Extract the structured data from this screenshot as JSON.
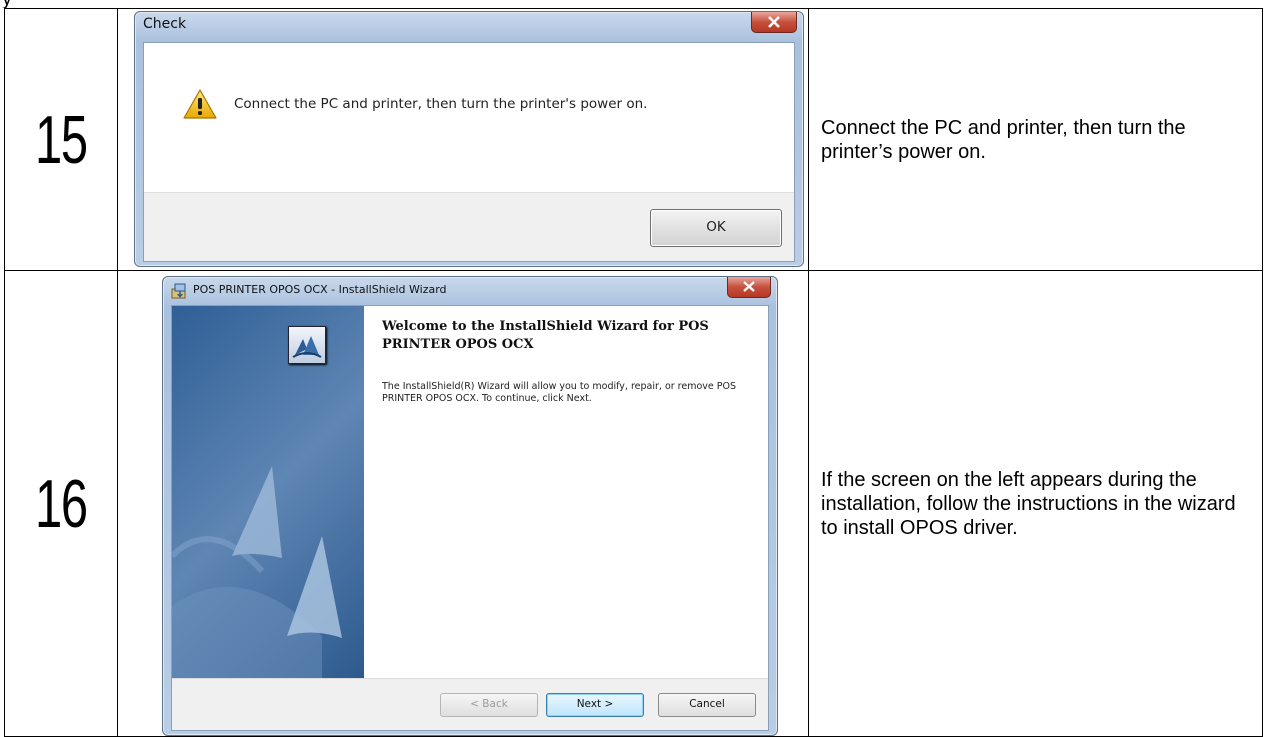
{
  "rows": [
    {
      "step": "15",
      "description": "Connect the PC and printer, then turn the printer’s power on.",
      "dialog": {
        "title": "Check",
        "message": "Connect the PC and printer, then turn the printer's power on.",
        "button": "OK",
        "icons": {
          "close": "close-x-icon",
          "message": "warning-triangle-icon"
        }
      }
    },
    {
      "step": "16",
      "description": "If the screen on the left appears during the installation, follow the instructions in the wizard to install OPOS driver.",
      "dialog": {
        "title": "POS PRINTER OPOS OCX - InstallShield Wizard",
        "heading": "Welcome to the InstallShield Wizard for POS PRINTER OPOS OCX",
        "body": "The InstallShield(R) Wizard will allow you to modify, repair, or remove POS PRINTER OPOS OCX. To continue, click Next.",
        "back": "< Back",
        "next": "Next >",
        "cancel": "Cancel",
        "icons": {
          "app": "installer-icon",
          "logo": "installshield-logo-icon",
          "close": "close-x-icon"
        }
      }
    }
  ]
}
